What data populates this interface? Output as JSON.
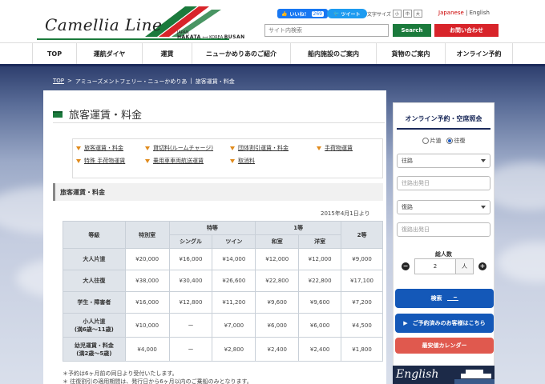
{
  "header": {
    "logo_text": "Camellia Line",
    "logo_sub_left_small": "JAPAN",
    "logo_sub_left": "HAKATA",
    "logo_sub_right_small": "KOREA",
    "logo_sub_right": "BUSAN",
    "fb_label": "いいね！",
    "fb_count": "269",
    "tweet_label": "ツイート",
    "textsize_label": "文字サイズ",
    "textsize_options": [
      "小",
      "中",
      "大"
    ],
    "lang_jp": "Japanese",
    "lang_sep": "|",
    "lang_en": "English",
    "search_placeholder": "サイト内検索",
    "search_button": "Search",
    "contact_button": "お問い合わせ",
    "colors": {
      "green": "#1b7a3c",
      "red": "#d8242a",
      "navy": "#1b2a5a"
    }
  },
  "nav": [
    "TOP",
    "運航ダイヤ",
    "運賃",
    "ニューかめりあのご紹介",
    "船内施設のご案内",
    "貨物のご案内",
    "オンライン予約"
  ],
  "breadcrumb": {
    "top": "TOP",
    "sep": ">",
    "item1": "アミューズメントフェリー・ニューかめりあ",
    "sep2": "|",
    "item2": "旅客運賃・料金"
  },
  "main": {
    "title": "旅客運賃・料金",
    "links": [
      [
        "旅客運賃・料金",
        "貸切料(ルームチャージ)",
        "団体割引運賃・料金",
        "手荷物運賃"
      ],
      [
        "特殊 手荷物運賃",
        "乗用車車両航送運賃",
        "取消料"
      ]
    ],
    "section_heading": "旅客運賃・料金",
    "date_note": "2015年4月1日より",
    "table": {
      "h_grade": "等級",
      "h_special": "特別室",
      "h_first": "特等",
      "h_first_single": "シングル",
      "h_first_twin": "ツイン",
      "h_second": "1等",
      "h_second_jp": "和室",
      "h_second_west": "洋室",
      "h_third": "2等",
      "rows": [
        {
          "label": "大人片道",
          "label2": "",
          "cells": [
            "¥20,000",
            "¥16,000",
            "¥14,000",
            "¥12,000",
            "¥12,000",
            "¥9,000"
          ]
        },
        {
          "label": "大人往復",
          "label2": "",
          "cells": [
            "¥38,000",
            "¥30,400",
            "¥26,600",
            "¥22,800",
            "¥22,800",
            "¥17,100"
          ]
        },
        {
          "label": "学生・障害者",
          "label2": "",
          "cells": [
            "¥16,000",
            "¥12,800",
            "¥11,200",
            "¥9,600",
            "¥9,600",
            "¥7,200"
          ]
        },
        {
          "label": "小人片道",
          "label2": "(満6歳～11歳)",
          "cells": [
            "¥10,000",
            "ー",
            "¥7,000",
            "¥6,000",
            "¥6,000",
            "¥4,500"
          ]
        },
        {
          "label": "幼児運賃・料金",
          "label2": "(満2歳～5歳)",
          "cells": [
            "¥4,000",
            "ー",
            "¥2,800",
            "¥2,400",
            "¥2,400",
            "¥1,800"
          ]
        }
      ]
    },
    "notes": [
      "＊予約は6ヶ月前の同日より受付いたします。",
      "＊ 往復割引の適用期間は、発行日から6ヶ月以内のご乗船のみとなります。"
    ]
  },
  "sidebar": {
    "title": "オンライン予約・空席照会",
    "radio_oneway": "片道",
    "radio_round": "往復",
    "radio_selected": "往復",
    "outbound_select": "往路",
    "outbound_date_placeholder": "往路出発日",
    "return_select": "復路",
    "return_date_placeholder": "復路出発日",
    "pax_label": "総人数",
    "pax_minus": "−",
    "pax_value": "2",
    "pax_unit": "人",
    "pax_plus": "+",
    "search_button": "検索",
    "booked_button": "ご予約済みのお客様はこちら",
    "calendar_button": "最安値カレンダー",
    "banner_text": "English"
  }
}
